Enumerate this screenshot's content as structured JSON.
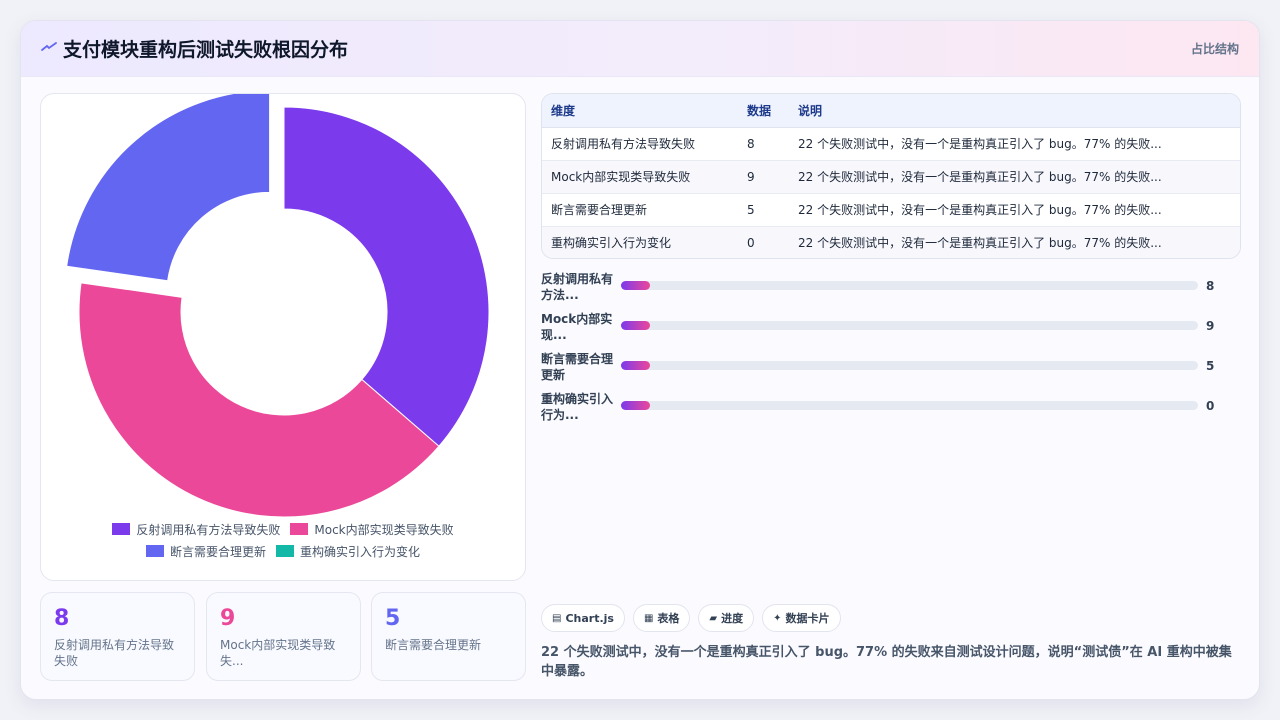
{
  "header": {
    "title": "支付模块重构后测试失败根因分布",
    "tag": "占比结构"
  },
  "colors": {
    "purple": "#7c3aed",
    "pink": "#ec4899",
    "indigo": "#6366f1",
    "teal": "#14b8a6"
  },
  "chart_data": {
    "type": "pie",
    "variant": "doughnut",
    "categories": [
      "反射调用私有方法导致失败",
      "Mock内部实现类导致失败",
      "断言需要合理更新",
      "重构确实引入行为变化"
    ],
    "values": [
      8,
      9,
      5,
      0
    ],
    "colors": [
      "#7c3aed",
      "#ec4899",
      "#6366f1",
      "#14b8a6"
    ],
    "legend_position": "bottom"
  },
  "stats": [
    {
      "value": "8",
      "label": "反射调用私有方法导致失败",
      "color": "#7c3aed"
    },
    {
      "value": "9",
      "label": "Mock内部实现类导致失...",
      "color": "#ec4899"
    },
    {
      "value": "5",
      "label": "断言需要合理更新",
      "color": "#6366f1"
    }
  ],
  "table": {
    "headers": [
      "维度",
      "数据",
      "说明"
    ],
    "rows": [
      [
        "反射调用私有方法导致失败",
        "8",
        "22 个失败测试中，没有一个是重构真正引入了 bug。77% 的失败..."
      ],
      [
        "Mock内部实现类导致失败",
        "9",
        "22 个失败测试中，没有一个是重构真正引入了 bug。77% 的失败..."
      ],
      [
        "断言需要合理更新",
        "5",
        "22 个失败测试中，没有一个是重构真正引入了 bug。77% 的失败..."
      ],
      [
        "重构确实引入行为变化",
        "0",
        "22 个失败测试中，没有一个是重构真正引入了 bug。77% 的失败..."
      ]
    ]
  },
  "bars": [
    {
      "label": "反射调用私有方法...",
      "value": 8
    },
    {
      "label": "Mock内部实现...",
      "value": 9
    },
    {
      "label": "断言需要合理更新",
      "value": 5
    },
    {
      "label": "重构确实引入行为...",
      "value": 0
    }
  ],
  "chips": [
    {
      "icon": "▤",
      "label": "Chart.js"
    },
    {
      "icon": "▦",
      "label": "表格"
    },
    {
      "icon": "▰",
      "label": "进度"
    },
    {
      "icon": "✦",
      "label": "数据卡片"
    }
  ],
  "footnote": "22 个失败测试中，没有一个是重构真正引入了 bug。77% 的失败来自测试设计问题，说明“测试债”在 AI 重构中被集中暴露。"
}
